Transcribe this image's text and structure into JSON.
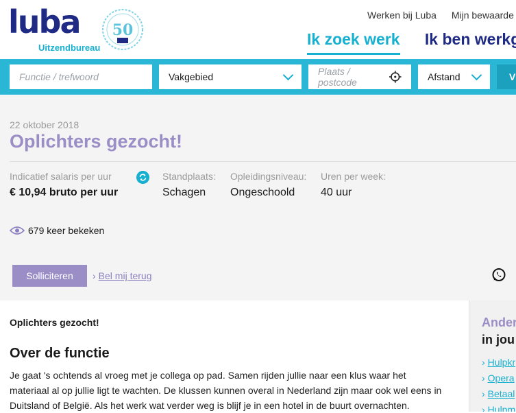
{
  "brand": {
    "logo_text": "luba",
    "logo_subtitle": "Uitzendbureau",
    "anniversary": "50",
    "colors": {
      "navy": "#1f2a85",
      "cyan": "#17b0d0",
      "lilac": "#9b8ec6"
    }
  },
  "header": {
    "top_links": [
      "Werken bij Luba",
      "Mijn bewaarde"
    ],
    "nav": {
      "active": "Ik zoek werk",
      "other": "Ik ben werkge"
    }
  },
  "search": {
    "keyword_placeholder": "Functie / trefwoord",
    "sector_value": "Vakgebied",
    "location_placeholder": "Plaats / postcode",
    "distance_value": "Afstand",
    "submit_label": "V"
  },
  "job": {
    "date": "22 oktober 2018",
    "title": "Oplichters gezocht!",
    "salary_label": "Indicatief salaris per uur",
    "salary_value": "€ 10,94 bruto per uur",
    "location_label": "Standplaats:",
    "location_value": "Schagen",
    "education_label": "Opleidingsniveau:",
    "education_value": "Ongeschoold",
    "hours_label": "Uren per week:",
    "hours_value": "40 uur",
    "views": "679 keer bekeken",
    "apply_label": "Solliciteren",
    "callback_label": "Bel mij terug"
  },
  "content": {
    "intro": "Oplichters gezocht!",
    "section_title": "Over de functie",
    "paragraph": "Je gaat 's ochtends al vroeg met je collega op pad. Samen rijden jullie naar een klus waar het materiaal al op jullie ligt te wachten. De klussen kunnen overal in Nederland zijn maar ook wel eens in Duitsland of België. Als het werk wat verder weg is blijf je in een hotel in de buurt overnachten."
  },
  "sidebar": {
    "heading_1": "Ander",
    "heading_2": "in jou",
    "links": [
      "Hulpkr",
      "Opera",
      "Betaal",
      "Hulpm"
    ]
  }
}
